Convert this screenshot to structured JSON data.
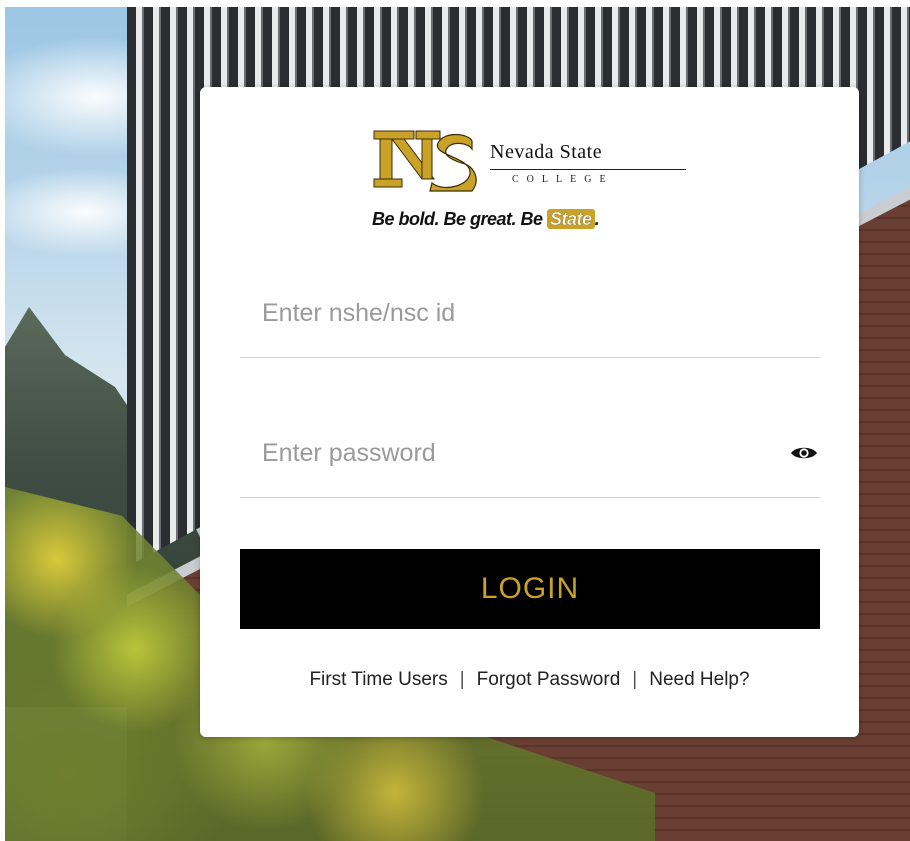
{
  "brand": {
    "name": "Nevada State",
    "subname": "COLLEGE",
    "tagline_prefix": "Be bold. Be great. Be ",
    "tagline_highlight": "State",
    "tagline_suffix": ".",
    "colors": {
      "gold": "#c9a227",
      "black": "#000000"
    }
  },
  "form": {
    "username_placeholder": "Enter nshe/nsc id",
    "password_placeholder": "Enter password",
    "show_password_icon": "eye-icon",
    "login_label": "LOGIN"
  },
  "links": {
    "first_time": "First Time Users",
    "forgot": "Forgot Password",
    "help": "Need Help?",
    "separator": "|"
  }
}
